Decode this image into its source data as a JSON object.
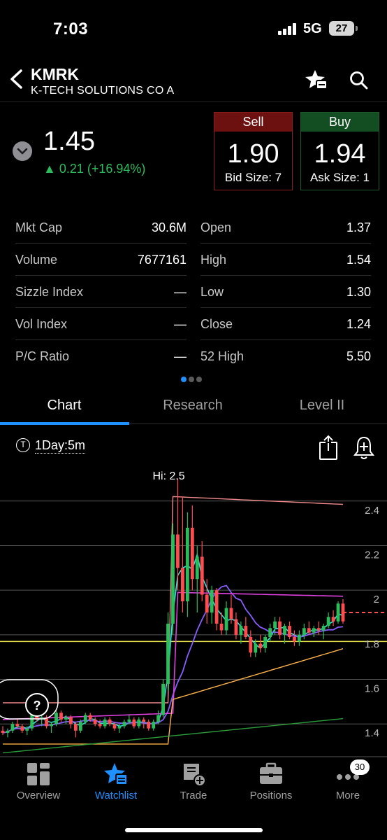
{
  "status": {
    "time": "7:03",
    "network": "5G",
    "battery": "27"
  },
  "header": {
    "symbol": "KMRK",
    "company": "K-TECH SOLUTIONS CO A"
  },
  "quote": {
    "last": "1.45",
    "change": "▲ 0.21 (+16.94%)",
    "sell": {
      "label": "Sell",
      "price": "1.90",
      "size": "Bid Size: 7"
    },
    "buy": {
      "label": "Buy",
      "price": "1.94",
      "size": "Ask Size: 1"
    }
  },
  "stats": {
    "left": [
      {
        "label": "Mkt Cap",
        "value": "30.6M"
      },
      {
        "label": "Volume",
        "value": "7677161"
      },
      {
        "label": "Sizzle Index",
        "value": "—"
      },
      {
        "label": "Vol Index",
        "value": "—"
      },
      {
        "label": "P/C Ratio",
        "value": "—"
      }
    ],
    "right": [
      {
        "label": "Open",
        "value": "1.37"
      },
      {
        "label": "High",
        "value": "1.54"
      },
      {
        "label": "Low",
        "value": "1.30"
      },
      {
        "label": "Close",
        "value": "1.24"
      },
      {
        "label": "52 High",
        "value": "5.50"
      }
    ]
  },
  "tabs": [
    "Chart",
    "Research",
    "Level II"
  ],
  "chart_toolbar": {
    "badge": "T",
    "interval": "1Day:5m"
  },
  "chart_data": {
    "type": "candlestick",
    "annotation": "Hi: 2.5",
    "y_ticks": [
      "2.4",
      "2.2",
      "2",
      "1.8",
      "1.6",
      "1.4"
    ],
    "ylim": [
      1.25,
      2.55
    ],
    "event_marker": "?",
    "last_price_line": 1.9,
    "reference_line": 1.77,
    "candles": [
      [
        1.37,
        1.39,
        1.35,
        1.36
      ],
      [
        1.36,
        1.38,
        1.34,
        1.37
      ],
      [
        1.37,
        1.41,
        1.36,
        1.4
      ],
      [
        1.4,
        1.42,
        1.38,
        1.39
      ],
      [
        1.39,
        1.4,
        1.36,
        1.37
      ],
      [
        1.37,
        1.39,
        1.35,
        1.38
      ],
      [
        1.38,
        1.46,
        1.37,
        1.44
      ],
      [
        1.44,
        1.47,
        1.41,
        1.42
      ],
      [
        1.42,
        1.44,
        1.39,
        1.43
      ],
      [
        1.43,
        1.44,
        1.38,
        1.39
      ],
      [
        1.39,
        1.41,
        1.36,
        1.4
      ],
      [
        1.4,
        1.46,
        1.39,
        1.45
      ],
      [
        1.45,
        1.46,
        1.41,
        1.42
      ],
      [
        1.42,
        1.44,
        1.4,
        1.43
      ],
      [
        1.43,
        1.44,
        1.38,
        1.4
      ],
      [
        1.4,
        1.41,
        1.34,
        1.37
      ],
      [
        1.37,
        1.42,
        1.36,
        1.41
      ],
      [
        1.41,
        1.45,
        1.4,
        1.44
      ],
      [
        1.44,
        1.45,
        1.41,
        1.42
      ],
      [
        1.42,
        1.43,
        1.39,
        1.4
      ],
      [
        1.4,
        1.42,
        1.38,
        1.39
      ],
      [
        1.39,
        1.43,
        1.38,
        1.42
      ],
      [
        1.42,
        1.43,
        1.39,
        1.4
      ],
      [
        1.4,
        1.41,
        1.37,
        1.38
      ],
      [
        1.38,
        1.4,
        1.36,
        1.39
      ],
      [
        1.39,
        1.42,
        1.38,
        1.41
      ],
      [
        1.41,
        1.44,
        1.4,
        1.42
      ],
      [
        1.42,
        1.43,
        1.38,
        1.39
      ],
      [
        1.39,
        1.43,
        1.38,
        1.42
      ],
      [
        1.42,
        1.43,
        1.38,
        1.41
      ],
      [
        1.41,
        1.42,
        1.37,
        1.38
      ],
      [
        1.38,
        1.42,
        1.37,
        1.41
      ],
      [
        1.41,
        1.46,
        1.4,
        1.44
      ],
      [
        1.44,
        1.6,
        1.43,
        1.58
      ],
      [
        1.58,
        1.9,
        1.55,
        1.85
      ],
      [
        1.85,
        2.3,
        1.8,
        2.25
      ],
      [
        2.25,
        2.5,
        2.0,
        2.1
      ],
      [
        2.1,
        2.42,
        1.9,
        1.95
      ],
      [
        1.95,
        2.35,
        1.88,
        2.28
      ],
      [
        2.28,
        2.38,
        2.0,
        2.05
      ],
      [
        2.05,
        2.2,
        1.9,
        2.15
      ],
      [
        2.15,
        2.22,
        1.95,
        1.98
      ],
      [
        1.98,
        2.05,
        1.85,
        1.9
      ],
      [
        1.9,
        2.02,
        1.85,
        2.0
      ],
      [
        2.0,
        2.01,
        1.82,
        1.85
      ],
      [
        1.85,
        1.9,
        1.8,
        1.82
      ],
      [
        1.82,
        1.95,
        1.8,
        1.92
      ],
      [
        1.92,
        1.98,
        1.85,
        1.87
      ],
      [
        1.87,
        1.9,
        1.78,
        1.8
      ],
      [
        1.8,
        1.86,
        1.76,
        1.84
      ],
      [
        1.84,
        1.88,
        1.78,
        1.79
      ],
      [
        1.79,
        1.82,
        1.7,
        1.72
      ],
      [
        1.72,
        1.78,
        1.7,
        1.76
      ],
      [
        1.76,
        1.8,
        1.72,
        1.74
      ],
      [
        1.74,
        1.8,
        1.72,
        1.79
      ],
      [
        1.79,
        1.85,
        1.77,
        1.83
      ],
      [
        1.83,
        1.88,
        1.8,
        1.86
      ],
      [
        1.86,
        1.88,
        1.78,
        1.8
      ],
      [
        1.8,
        1.85,
        1.76,
        1.84
      ],
      [
        1.84,
        1.86,
        1.78,
        1.79
      ],
      [
        1.79,
        1.82,
        1.75,
        1.77
      ],
      [
        1.77,
        1.82,
        1.75,
        1.8
      ],
      [
        1.8,
        1.85,
        1.78,
        1.83
      ],
      [
        1.83,
        1.86,
        1.8,
        1.81
      ],
      [
        1.81,
        1.84,
        1.79,
        1.83
      ],
      [
        1.83,
        1.86,
        1.8,
        1.82
      ],
      [
        1.82,
        1.85,
        1.78,
        1.84
      ],
      [
        1.84,
        1.9,
        1.83,
        1.88
      ],
      [
        1.88,
        1.91,
        1.84,
        1.86
      ],
      [
        1.86,
        1.95,
        1.85,
        1.94
      ],
      [
        1.94,
        1.96,
        1.85,
        1.86
      ]
    ]
  },
  "bottom_nav": [
    {
      "label": "Overview",
      "icon": "overview-icon"
    },
    {
      "label": "Watchlist",
      "icon": "watchlist-icon",
      "active": true
    },
    {
      "label": "Trade",
      "icon": "trade-icon"
    },
    {
      "label": "Positions",
      "icon": "positions-icon"
    },
    {
      "label": "More",
      "icon": "more-icon",
      "badge": "30"
    }
  ],
  "colors": {
    "up": "#2bbd5a",
    "down": "#ff4d4f",
    "accent": "#1e90ff"
  }
}
